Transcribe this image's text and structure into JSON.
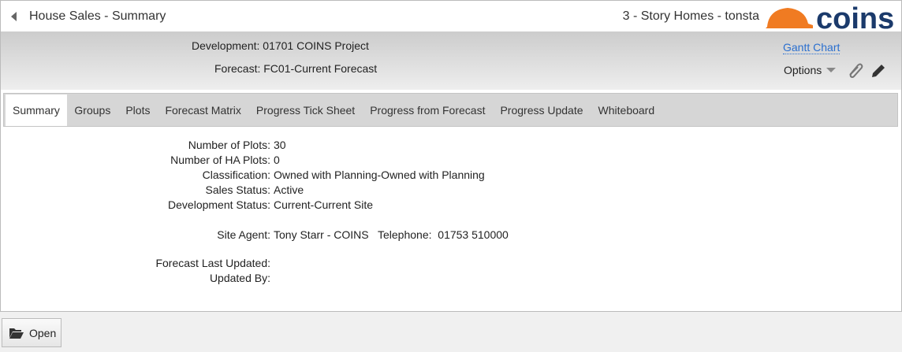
{
  "titlebar": {
    "title": "House Sales - Summary",
    "user": "3 - Story Homes - tonsta",
    "logo": "COINS"
  },
  "header": {
    "development_label": "Development:",
    "development": "01701 COINS Project",
    "forecast_label": "Forecast:",
    "forecast": "FC01-Current Forecast",
    "gantt": "Gantt Chart",
    "options": "Options"
  },
  "tabs": [
    "Summary",
    "Groups",
    "Plots",
    "Forecast Matrix",
    "Progress Tick Sheet",
    "Progress from Forecast",
    "Progress Update",
    "Whiteboard"
  ],
  "fields": {
    "plots_label": "Number of Plots:",
    "plots": "30",
    "ha_label": "Number of HA Plots:",
    "ha": "0",
    "class_label": "Classification:",
    "class": "Owned with Planning-Owned with Planning",
    "sales_label": "Sales Status:",
    "sales": "Active",
    "dev_label": "Development Status:",
    "dev": "Current-Current Site",
    "agent_label": "Site Agent:",
    "agent": "Tony Starr - COINS   Telephone:  01753 510000",
    "updated_label": "Forecast Last Updated:",
    "updated": "",
    "by_label": "Updated By:",
    "by": ""
  },
  "footer": {
    "open": "Open"
  }
}
